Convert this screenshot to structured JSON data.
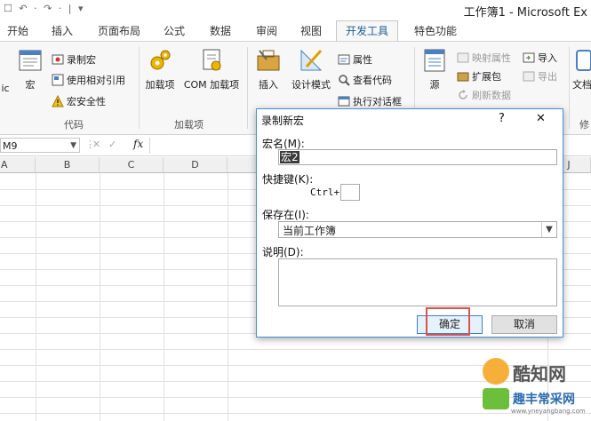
{
  "titlebar": {
    "quick_access": "☐ ↶ · ↷ · | ▾",
    "title": "工作簿1 - Microsoft Ex"
  },
  "tabs": [
    "开始",
    "插入",
    "页面布局",
    "公式",
    "数据",
    "审阅",
    "视图",
    "开发工具",
    "特色功能"
  ],
  "ribbon": {
    "code": {
      "left_clip": "ic",
      "macro": "宏",
      "record": "录制宏",
      "relative": "使用相对引用",
      "security": "宏安全性",
      "label": "代码"
    },
    "addins": {
      "addin": "加载项",
      "com_addin": "COM 加载项",
      "label": "加载项"
    },
    "controls": {
      "insert": "插入",
      "design": "设计模式",
      "properties": "属性",
      "view_code": "查看代码",
      "run_dialog": "执行对话框"
    },
    "xml": {
      "source": "源",
      "map_props": "映射属性",
      "import": "导入",
      "expansion": "扩展包",
      "export": "导出",
      "refresh": "刷新数据"
    },
    "right_clip": "文档",
    "right_clip2": "修"
  },
  "formula_bar": {
    "namebox": "M9",
    "fx": "fx"
  },
  "columns": [
    "A",
    "B",
    "C",
    "D",
    "E",
    "J"
  ],
  "dialog": {
    "title": "录制新宏",
    "help": "?",
    "close": "✕",
    "macro_name_label": "宏名(M):",
    "macro_name_value": "宏2",
    "shortcut_label": "快捷键(K):",
    "ctrl_label": "Ctrl+",
    "shortcut_value": "",
    "store_label": "保存在(I):",
    "store_value": "当前工作簿",
    "desc_label": "说明(D):",
    "desc_value": "",
    "ok": "确定",
    "cancel": "取消"
  },
  "watermark": {
    "logo_text": "酷知网",
    "sub_text": "趣丰常采网",
    "url": "www.yneyangbang.com"
  },
  "colors": {
    "accent": "#1e5c96",
    "dialog_border": "#4a90d9",
    "highlight": "#d9534f"
  }
}
